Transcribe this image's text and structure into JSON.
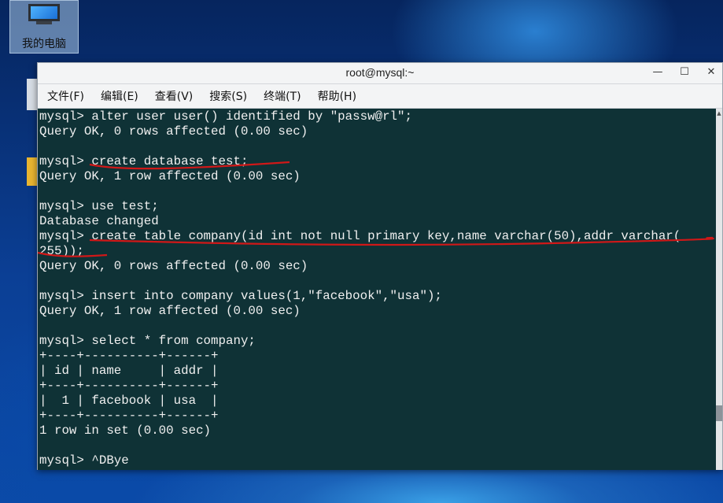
{
  "desktop": {
    "icon_label": "我的电脑"
  },
  "window": {
    "title": "root@mysql:~",
    "minimize": "—",
    "maximize": "☐",
    "close": "✕"
  },
  "menu": [
    {
      "label": "文件(F)"
    },
    {
      "label": "编辑(E)"
    },
    {
      "label": "查看(V)"
    },
    {
      "label": "搜索(S)"
    },
    {
      "label": "终端(T)"
    },
    {
      "label": "帮助(H)"
    }
  ],
  "terminal": {
    "lines": [
      "mysql> alter user user() identified by \"passw@rl\";",
      "Query OK, 0 rows affected (0.00 sec)",
      "",
      "mysql> create database test;",
      "Query OK, 1 row affected (0.00 sec)",
      "",
      "mysql> use test;",
      "Database changed",
      "mysql> create table company(id int not null primary key,name varchar(50),addr varchar(",
      "255));",
      "Query OK, 0 rows affected (0.00 sec)",
      "",
      "mysql> insert into company values(1,\"facebook\",\"usa\");",
      "Query OK, 1 row affected (0.00 sec)",
      "",
      "mysql> select * from company;",
      "+----+----------+------+",
      "| id | name     | addr |",
      "+----+----------+------+",
      "|  1 | facebook | usa  |",
      "+----+----------+------+",
      "1 row in set (0.00 sec)",
      "",
      "mysql> ^DBye"
    ]
  },
  "colors": {
    "terminal_bg": "#0f3236",
    "terminal_fg": "#f0f0f0",
    "annotation": "#d01818"
  }
}
